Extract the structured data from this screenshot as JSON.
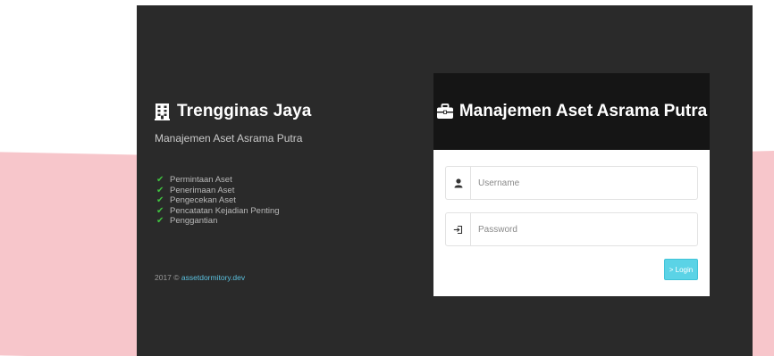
{
  "brand": {
    "title": "Trengginas Jaya",
    "subtitle": "Manajemen Aset Asrama Putra",
    "icon": "building-icon"
  },
  "features": [
    "Permintaan Aset",
    "Penerimaan Aset",
    "Pengecekan Aset",
    "Pencatatan Kejadian Penting",
    "Penggantian"
  ],
  "footer": {
    "prefix": "2017 © ",
    "link_text": "assetdormitory.dev"
  },
  "login": {
    "header_title": "Manajemen Aset Asrama Putra",
    "header_icon": "briefcase-icon",
    "username_placeholder": "Username",
    "username_value": "",
    "password_placeholder": "Password",
    "password_value": "",
    "button_label": "> Login"
  },
  "colors": {
    "panel_bg": "#2a2a2a",
    "card_header_bg": "#151515",
    "accent": "#5bd3e6",
    "check": "#3fc23f",
    "band": "#f7c6cb"
  }
}
